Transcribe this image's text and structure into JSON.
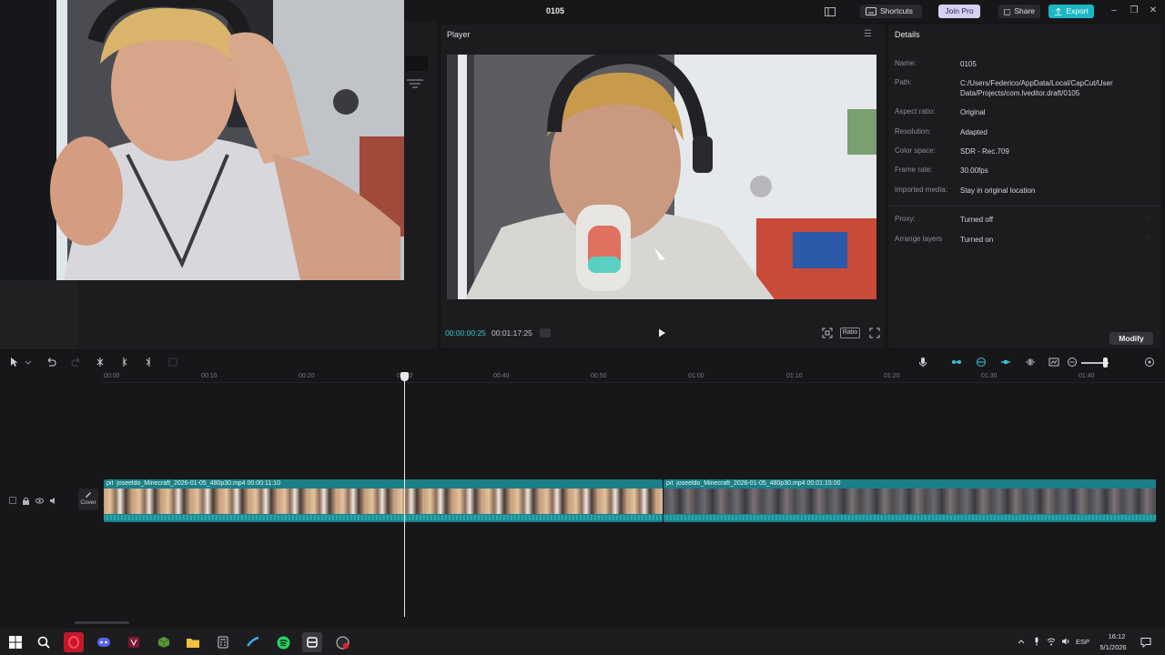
{
  "window": {
    "title": "0105",
    "shortcuts_label": "Shortcuts",
    "join_pro_label": "Join Pro",
    "share_label": "Share",
    "export_label": "Export"
  },
  "player": {
    "header": "Player",
    "timecode_current": "00:00:00:25",
    "timecode_total": "00:01:17:25",
    "ratio_label": "Ratio"
  },
  "details": {
    "title": "Details",
    "rows": [
      {
        "label": "Name:",
        "value": "0105"
      },
      {
        "label": "Path:",
        "value": "C:/Users/Federico/AppData/Local/CapCut/User Data/Projects/com.lveditor.draft/0105"
      },
      {
        "label": "Aspect ratio:",
        "value": "Original"
      },
      {
        "label": "Resolution:",
        "value": "Adapted"
      },
      {
        "label": "Color space:",
        "value": "SDR - Rec.709"
      },
      {
        "label": "Frame rate:",
        "value": "30.00fps"
      },
      {
        "label": "Imported media:",
        "value": "Stay in original location"
      },
      {
        "label": "Proxy:",
        "value": "Turned off"
      },
      {
        "label": "Arrange layers",
        "value": "Turned on"
      }
    ],
    "modify_label": "Modify"
  },
  "timeline": {
    "ruler_ticks": [
      "00:00",
      "00:10",
      "00:20",
      "00:30",
      "00:40",
      "00:50",
      "01:00",
      "01:10",
      "01:20",
      "01:30",
      "01:40"
    ],
    "cover_label": "Cover",
    "clips": [
      {
        "label": "joseeldo_Minecraft_2026-01-05_480p30.mp4  00:00:11:10",
        "prefix": "pit"
      },
      {
        "label": "joseeldo_Minecraft_2026-01-05_480p30.mp4  00:01:15:00",
        "prefix": "pit"
      }
    ]
  },
  "taskbar": {
    "time": "16:12",
    "date": "5/1/2026",
    "language": "ESP"
  },
  "colors": {
    "accent": "#1bb8c4",
    "clip": "#1a7f86",
    "background": "#151517"
  }
}
